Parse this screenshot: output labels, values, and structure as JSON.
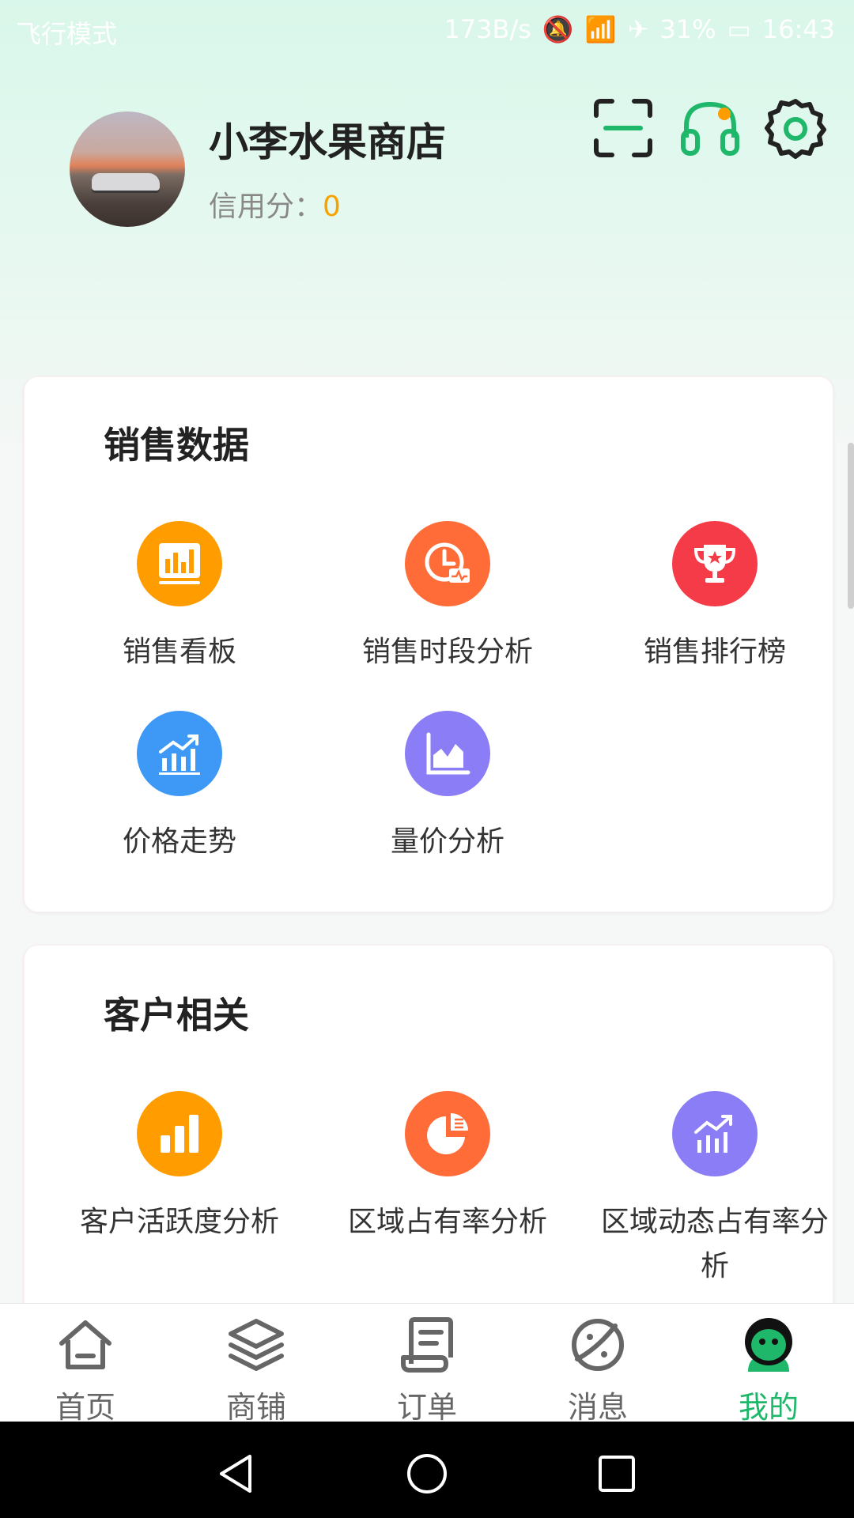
{
  "status_bar": {
    "left_text": "飞行模式",
    "speed": "173B/s",
    "battery": "31%",
    "time": "16:43"
  },
  "profile": {
    "shop_name": "小李水果商店",
    "credit_label": "信用分：",
    "credit_value": "0"
  },
  "top_actions": {
    "icons": [
      "scan-icon",
      "customer-service-icon",
      "settings-icon"
    ],
    "accent": "#1fb86b"
  },
  "sales_section": {
    "title": "销售数据",
    "items": [
      {
        "label": "销售看板",
        "icon": "dashboard-chart-icon",
        "color": "#ff9d00"
      },
      {
        "label": "销售时段分析",
        "icon": "clock-chart-icon",
        "color": "#ff6c37"
      },
      {
        "label": "销售排行榜",
        "icon": "trophy-icon",
        "color": "#f53b47"
      },
      {
        "label": "价格走势",
        "icon": "trend-chart-icon",
        "color": "#3d99f5"
      },
      {
        "label": "量价分析",
        "icon": "area-chart-icon",
        "color": "#8a7df5"
      }
    ]
  },
  "customer_section": {
    "title": "客户相关",
    "items": [
      {
        "label": "客户活跃度分析",
        "icon": "bar-chart-icon",
        "color": "#ff9d00"
      },
      {
        "label": "区域占有率分析",
        "icon": "pie-chart-icon",
        "color": "#ff6c37"
      },
      {
        "label": "区域动态占有率分析",
        "icon": "growth-chart-icon",
        "color": "#8a7df5"
      }
    ]
  },
  "tabs": [
    {
      "label": "首页",
      "icon": "home-icon"
    },
    {
      "label": "商铺",
      "icon": "layers-icon"
    },
    {
      "label": "订单",
      "icon": "order-list-icon"
    },
    {
      "label": "消息",
      "icon": "planet-icon"
    },
    {
      "label": "我的",
      "icon": "profile-avatar-icon",
      "active": true
    }
  ]
}
